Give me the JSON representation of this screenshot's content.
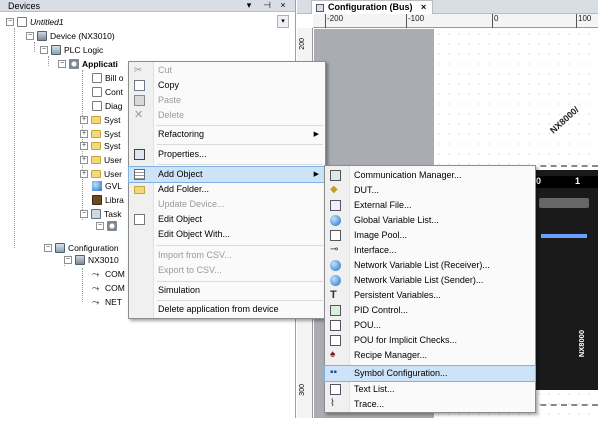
{
  "devices_panel": {
    "title": "Devices",
    "controls": [
      "▾",
      "⊣",
      "×"
    ],
    "tree": [
      {
        "label": "Untitled1",
        "level": 0
      },
      {
        "label": "Device (NX3010)",
        "level": 1
      },
      {
        "label": "PLC Logic",
        "level": 2
      },
      {
        "label": "Applicati",
        "level": 3
      },
      {
        "label": "Bill o",
        "level": 4
      },
      {
        "label": "Cont",
        "level": 4
      },
      {
        "label": "Diag",
        "level": 4
      },
      {
        "label": "Syst",
        "level": 4
      },
      {
        "label": "Syst",
        "level": 4
      },
      {
        "label": "Syst",
        "level": 4
      },
      {
        "label": "User",
        "level": 4
      },
      {
        "label": "User",
        "level": 4
      },
      {
        "label": "GVL",
        "level": 4
      },
      {
        "label": "Libra",
        "level": 4
      },
      {
        "label": "Task",
        "level": 4
      },
      {
        "label": "",
        "level": 5
      },
      {
        "label": "Configuration",
        "level": 1
      },
      {
        "label": "NX3010",
        "level": 2
      },
      {
        "label": "COM",
        "level": 3
      },
      {
        "label": "COM",
        "level": 3
      },
      {
        "label": "NET",
        "level": 3
      }
    ]
  },
  "editor": {
    "tab_label": "Configuration (Bus)",
    "tab_close": "×",
    "ruler_top": [
      "-200",
      "-100",
      "0",
      "100"
    ],
    "ruler_left": [
      "200",
      "300"
    ],
    "module": {
      "slot_left": "0",
      "slot_right": "1",
      "rotated_label": "NX8000/",
      "side_label": "NX8000"
    }
  },
  "context_menu": {
    "items": [
      {
        "label": "Cut",
        "icon": "cut-icon",
        "disabled": true
      },
      {
        "label": "Copy",
        "icon": "copy-icon",
        "disabled": false
      },
      {
        "label": "Paste",
        "icon": "paste-icon",
        "disabled": true
      },
      {
        "label": "Delete",
        "icon": "delete-icon",
        "disabled": true
      },
      {
        "label": "Refactoring",
        "icon": "",
        "disabled": false,
        "submenu": true
      },
      {
        "label": "Properties...",
        "icon": "properties-icon",
        "disabled": false
      },
      {
        "label": "Add Object",
        "icon": "add-object-icon",
        "disabled": false,
        "submenu": true,
        "highlighted": true
      },
      {
        "label": "Add Folder...",
        "icon": "folder-icon",
        "disabled": false
      },
      {
        "label": "Update Device...",
        "icon": "",
        "disabled": true
      },
      {
        "label": "Edit Object",
        "icon": "edit-icon",
        "disabled": false
      },
      {
        "label": "Edit Object With...",
        "icon": "",
        "disabled": false
      },
      {
        "label": "Import from CSV...",
        "icon": "",
        "disabled": true
      },
      {
        "label": "Export to CSV...",
        "icon": "",
        "disabled": true
      },
      {
        "label": "Simulation",
        "icon": "",
        "disabled": false
      },
      {
        "label": "Delete application from device",
        "icon": "",
        "disabled": false
      }
    ]
  },
  "submenu": {
    "items": [
      {
        "label": "Communication Manager...",
        "icon": "communication-icon"
      },
      {
        "label": "DUT...",
        "icon": "dut-icon"
      },
      {
        "label": "External File...",
        "icon": "external-file-icon"
      },
      {
        "label": "Global Variable List...",
        "icon": "globe-icon"
      },
      {
        "label": "Image Pool...",
        "icon": "image-pool-icon"
      },
      {
        "label": "Interface...",
        "icon": "interface-icon"
      },
      {
        "label": "Network Variable List (Receiver)...",
        "icon": "globe-icon"
      },
      {
        "label": "Network Variable List (Sender)...",
        "icon": "globe-icon"
      },
      {
        "label": "Persistent Variables...",
        "icon": "persistent-icon"
      },
      {
        "label": "PID Control...",
        "icon": "pid-icon"
      },
      {
        "label": "POU...",
        "icon": "pou-icon"
      },
      {
        "label": "POU for Implicit Checks...",
        "icon": "pou-icon"
      },
      {
        "label": "Recipe Manager...",
        "icon": "recipe-icon"
      },
      {
        "label": "Symbol Configuration...",
        "icon": "symbol-config-icon",
        "highlighted": true
      },
      {
        "label": "Text List...",
        "icon": "text-list-icon"
      },
      {
        "label": "Trace...",
        "icon": "trace-icon"
      }
    ]
  }
}
